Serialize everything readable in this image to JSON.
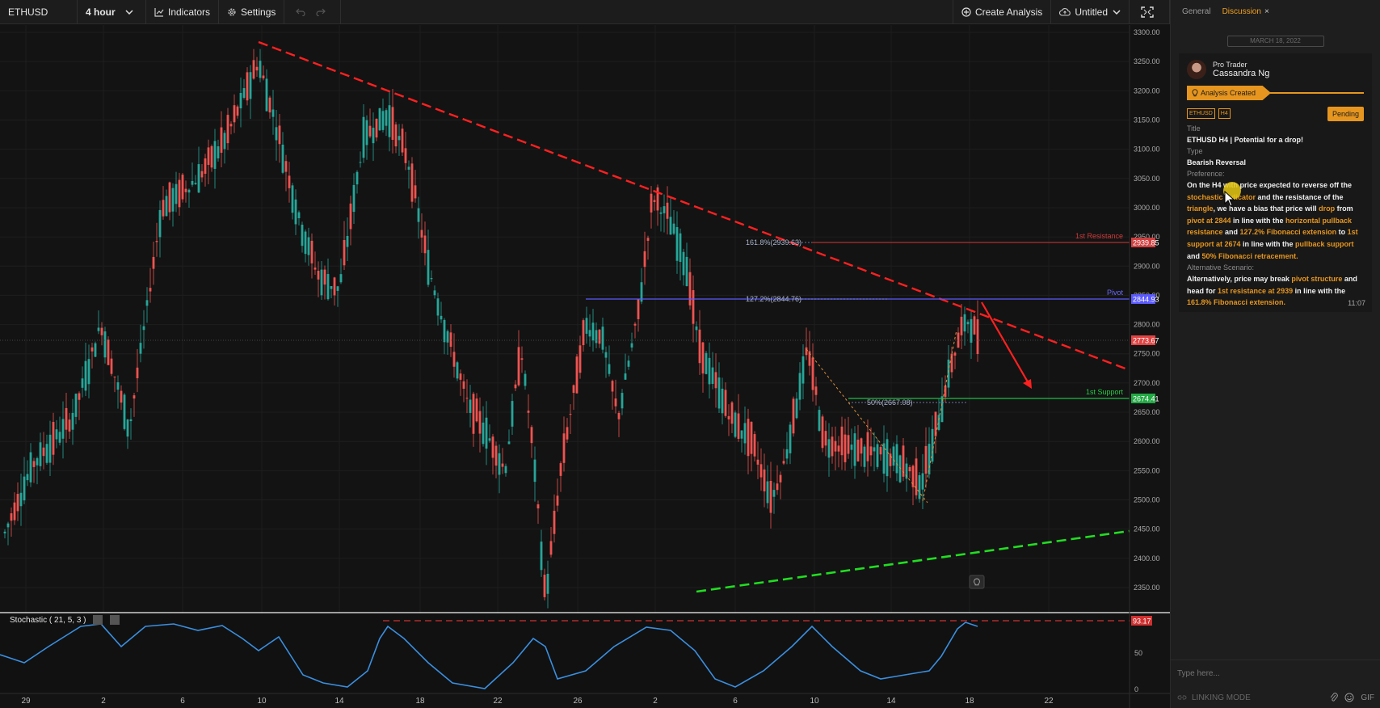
{
  "toolbar": {
    "symbol": "ETHUSD",
    "interval": "4 hour",
    "indicators": "Indicators",
    "settings": "Settings",
    "create_analysis": "Create Analysis",
    "layout_name": "Untitled"
  },
  "chart": {
    "price_axis": [
      "3300.00",
      "3250.00",
      "3200.00",
      "3150.00",
      "3100.00",
      "3050.00",
      "3000.00",
      "2950.00",
      "2900.00",
      "2850.00",
      "2800.00",
      "2750.00",
      "2700.00",
      "2650.00",
      "2600.00",
      "2550.00",
      "2500.00",
      "2450.00",
      "2400.00",
      "2350.00"
    ],
    "time_axis": [
      "29",
      "2",
      "6",
      "10",
      "14",
      "18",
      "22",
      "26",
      "2",
      "6",
      "10",
      "14",
      "18",
      "22"
    ],
    "levels": {
      "resistance": {
        "label": "1st Resistance",
        "value": "2939.85"
      },
      "pivot": {
        "label": "Pivot",
        "value": "2844.93"
      },
      "support": {
        "label": "1st Support",
        "value": "2674.41"
      },
      "current": {
        "value": "2773.67"
      }
    },
    "fib": {
      "ext_1618": "161.8%(2939.63)",
      "ext_1272": "127.2%(2844.76)",
      "ret_50": "50%(2667.08)"
    },
    "indicator": {
      "name": "Stochastic ( 21, 5, 3 )",
      "value": "93.17",
      "axis": [
        "50",
        "0"
      ]
    },
    "colors": {
      "up": "#26a69a",
      "down": "#ef5350",
      "trend_resistance": "#ff2020",
      "trend_support": "#22dd22",
      "pivot": "#5a5aff"
    }
  },
  "panel": {
    "tabs": [
      "General",
      "Discussion"
    ],
    "close": "×",
    "date": "MARCH 18, 2022",
    "author_role": "Pro Trader",
    "author_name": "Cassandra Ng",
    "status": "Analysis Created",
    "tags": [
      "ETHUSD",
      "H4"
    ],
    "state": "Pending",
    "title_label": "Title",
    "title": "ETHUSD H4 | Potential for a drop!",
    "type_label": "Type",
    "type": "Bearish Reversal",
    "pref_label": "Preference:",
    "preference": [
      {
        "t": "On the H4 with price expected to reverse off the ",
        "h": false
      },
      {
        "t": "stochastic indicator",
        "h": true
      },
      {
        "t": " and the resistance of the ",
        "h": false
      },
      {
        "t": "triangle",
        "h": true
      },
      {
        "t": ", we have a bias that price will ",
        "h": false
      },
      {
        "t": "drop",
        "h": true
      },
      {
        "t": " from ",
        "h": false
      },
      {
        "t": "pivot at 2844",
        "h": true
      },
      {
        "t": " in line with the ",
        "h": false
      },
      {
        "t": "horizontal pullback resistance",
        "h": true
      },
      {
        "t": " and ",
        "h": false
      },
      {
        "t": "127.2% Fibonacci extension",
        "h": true
      },
      {
        "t": " to ",
        "h": false
      },
      {
        "t": "1st support at 2674",
        "h": true
      },
      {
        "t": " in line with the ",
        "h": false
      },
      {
        "t": "pullback support",
        "h": true
      },
      {
        "t": " and ",
        "h": false
      },
      {
        "t": "50% Fibonacci retracement.",
        "h": true
      }
    ],
    "alt_label": "Alternative Scenario:",
    "alternative": [
      {
        "t": "Alternatively, price may break ",
        "h": false
      },
      {
        "t": "pivot structure",
        "h": true
      },
      {
        "t": " and head for ",
        "h": false
      },
      {
        "t": "1st resistance at 2939",
        "h": true
      },
      {
        "t": " in line with the ",
        "h": false
      },
      {
        "t": "161.8% Fibonacci extension.",
        "h": true
      }
    ],
    "time": "11:07",
    "message_placeholder": "Type here...",
    "linking_mode": "LINKING MODE",
    "gif": "GIF"
  }
}
